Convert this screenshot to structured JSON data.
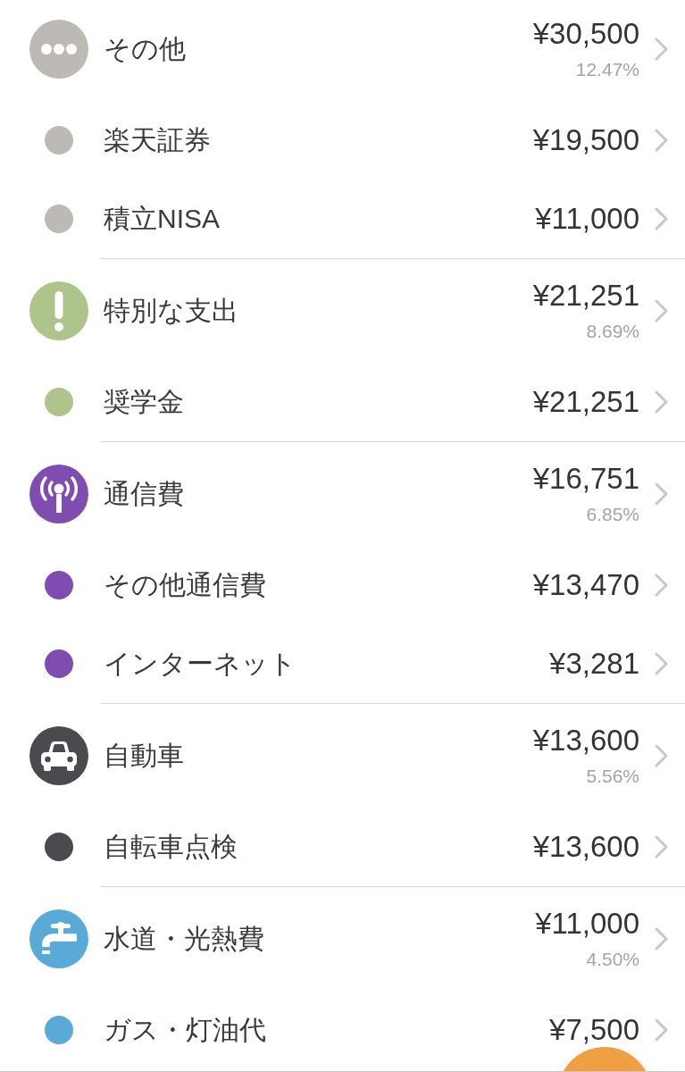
{
  "groups": [
    {
      "kind": "dots",
      "color": "#bdbab5",
      "name": "その他",
      "amount": "¥30,500",
      "percent": "12.47%",
      "items": [
        {
          "name": "楽天証券",
          "amount": "¥19,500"
        },
        {
          "name": "積立NISA",
          "amount": "¥11,000"
        }
      ]
    },
    {
      "kind": "exclamation",
      "color": "#aec48b",
      "name": "特別な支出",
      "amount": "¥21,251",
      "percent": "8.69%",
      "items": [
        {
          "name": "奨学金",
          "amount": "¥21,251"
        }
      ]
    },
    {
      "kind": "antenna",
      "color": "#7f4caf",
      "name": "通信費",
      "amount": "¥16,751",
      "percent": "6.85%",
      "items": [
        {
          "name": "その他通信費",
          "amount": "¥13,470"
        },
        {
          "name": "インターネット",
          "amount": "¥3,281"
        }
      ]
    },
    {
      "kind": "car",
      "color": "#4a4a4f",
      "name": "自動車",
      "amount": "¥13,600",
      "percent": "5.56%",
      "items": [
        {
          "name": "自転車点検",
          "amount": "¥13,600"
        }
      ]
    },
    {
      "kind": "faucet",
      "color": "#5aaad8",
      "name": "水道・光熱費",
      "amount": "¥11,000",
      "percent": "4.50%",
      "items": [
        {
          "name": "ガス・灯油代",
          "amount": "¥7,500"
        }
      ]
    }
  ]
}
